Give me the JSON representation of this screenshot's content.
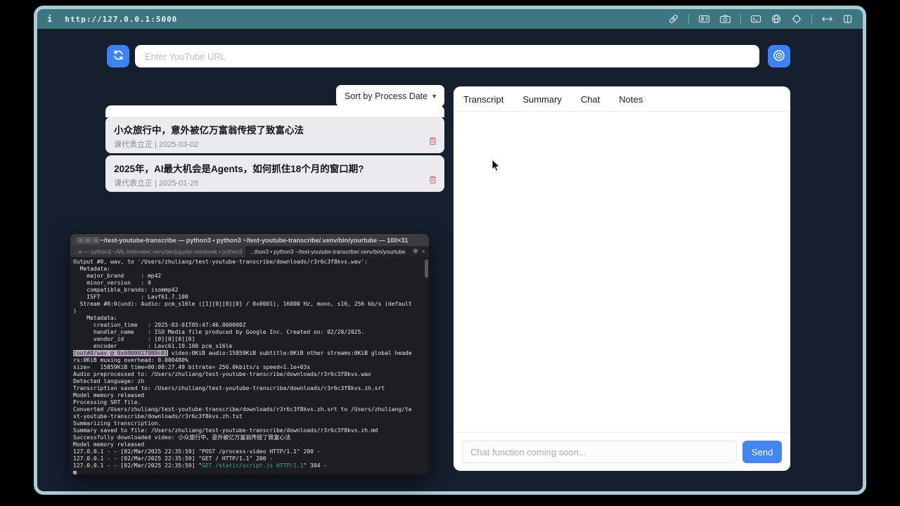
{
  "colors": {
    "frame": "#a9cbd5",
    "topbar": "#3d7580",
    "window_bg": "#161f2e",
    "accent_blue": "#3b82f6",
    "send_blue": "#4285f4",
    "item_bg": "#ecebee",
    "trash_red": "#e26b77",
    "terminal_bg": "#1e1e20",
    "terminal_highlight_bg": "#b5a7c3",
    "terminal_green": "#3fa893"
  },
  "browser": {
    "info_icon": "i",
    "url": "http://127.0.0.1:5000",
    "toolbar_icons": [
      "link-icon",
      "id-card-icon",
      "camera-icon",
      "terminal-window-icon",
      "globe-icon",
      "crosshair-icon",
      "resize-horizontal-icon",
      "split-pane-icon"
    ]
  },
  "url_bar": {
    "placeholder": "Enter YouTube URL"
  },
  "sort": {
    "label": "Sort by Process Date",
    "chevron": "▼"
  },
  "list": {
    "meta_separator": "|"
  },
  "videos": [
    {
      "title": "小众旅行中，意外被亿万富翁传授了致富心法",
      "channel": "课代表立正",
      "date": "2025-03-02"
    },
    {
      "title": "2025年，AI最大机会是Agents，如何抓住18个月的窗口期?",
      "channel": "课代表立正",
      "date": "2025-01-26"
    }
  ],
  "panel": {
    "tabs": [
      "Transcript",
      "Summary",
      "Chat",
      "Notes"
    ],
    "chat_placeholder": "Chat function coming soon...",
    "send_label": "Send"
  },
  "terminal": {
    "title": "~/test-youtube-transcribe — python3 • python3 ~/test-youtube-transcribe/.venv/bin/yourtube — 100×31",
    "tab_inactive": "...w — python3 ~/ML-Interview/.venv/bin/jupyter-notebook • python3",
    "tab_active": "...thon3 • python3 ~/test-youtube-transcribe/.venv/bin/yourtube",
    "new_tab_label": "+",
    "lines": [
      "Output #0, wav, to '/Users/zhuliang/test-youtube-transcribe/downloads/r3r6c3f8kvs.wav':",
      "  Metadata:",
      "    major_brand     : mp42",
      "    minor_version   : 0",
      "    compatible_brands: isommp42",
      "    ISFT            : Lavf61.7.100",
      "  Stream #0:0(und): Audio: pcm_s16le ([1][0][0][0] / 0x0001), 16000 Hz, mono, s16, 256 kb/s (default",
      ")",
      "    Metadata:",
      "      creation_time   : 2025-03-01T05:47:46.000000Z",
      "      handler_name    : ISO Media file produced by Google Inc. Created on: 02/28/2025.",
      "      vendor_id       : [0][0][0][0]",
      "      encoder         : Lavc61.19.100 pcm_s16le",
      [
        {
          "t": "[out#0/wav @ 0x6000017980c0]",
          "s": "hl"
        },
        {
          "t": " video:0KiB audio:15859KiB subtitle:0KiB other streams:0KiB global heade"
        }
      ],
      "rs:0KiB muxing overhead: 0.000480%",
      "size=   15859KiB time=00:08:27.49 bitrate= 256.0kbits/s speed=1.1e+03x",
      "Audio preprocessed to: /Users/zhuliang/test-youtube-transcribe/downloads/r3r6c3f8kvs.wav",
      "Detected language: zh",
      "Transcription saved to: /Users/zhuliang/test-youtube-transcribe/downloads/r3r6c3f8kvs.zh.srt",
      "Model memory released",
      "Processing SRT file.",
      "Converted /Users/zhuliang/test-youtube-transcribe/downloads/r3r6c3f8kvs.zh.srt to /Users/zhuliang/te",
      "st-youtube-transcribe/downloads/r3r6c3f8kvs.zh.txt",
      "Summarizing transcription.",
      "Summary saved to file: /Users/zhuliang/test-youtube-transcribe/downloads/r3r6c3f8kvs.zh.md",
      "Successfully downloaded video: 小众旅行中，意外被亿万富翁传授了致富心法",
      "Model memory released",
      "127.0.0.1 - - [02/Mar/2025 22:35:59] \"POST /process-video HTTP/1.1\" 200 -",
      "127.0.0.1 - - [02/Mar/2025 22:35:59] \"GET / HTTP/1.1\" 200 -",
      [
        {
          "t": "127.0.0.1 - - [02/Mar/2025 22:35:59] \""
        },
        {
          "t": "GET /static/script.js HTTP/1.1",
          "s": "green"
        },
        {
          "t": "\" 304 -"
        }
      ],
      [
        {
          "t": " ",
          "s": "cursor"
        }
      ]
    ]
  }
}
